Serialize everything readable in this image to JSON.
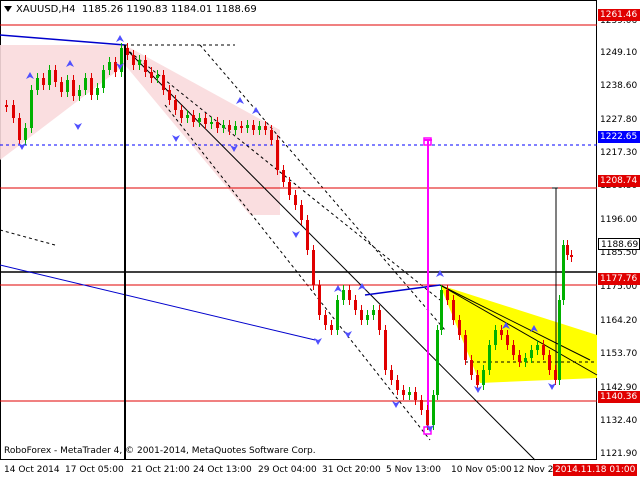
{
  "header": {
    "symbol": "XAUUSD,H4",
    "ohlc": "1185.26 1190.83 1184.01 1188.69"
  },
  "footer": {
    "copyright": "RoboForex - MetaTrader 4, © 2001-2014, MetaQuotes Software Corp."
  },
  "price_axis": {
    "ticks": [
      "1259.06",
      "1249.10",
      "1238.60",
      "1227.80",
      "1217.30",
      "1206.80",
      "1196.00",
      "1185.50",
      "1175.00",
      "1164.20",
      "1153.70",
      "1142.90",
      "1132.40",
      "1121.90"
    ],
    "labels": [
      {
        "text": "1261.46",
        "kind": "red"
      },
      {
        "text": "1222.65",
        "kind": "blue"
      },
      {
        "text": "1208.74",
        "kind": "red"
      },
      {
        "text": "1188.69",
        "kind": "current"
      },
      {
        "text": "1177.76",
        "kind": "red"
      },
      {
        "text": "1140.36",
        "kind": "red"
      }
    ]
  },
  "time_axis": {
    "ticks": [
      "14 Oct 2014",
      "17 Oct 05:00",
      "21 Oct 21:00",
      "24 Oct 13:00",
      "29 Oct 04:00",
      "31 Oct 20:00",
      "5 Nov 13:00",
      "10 Nov 05:00",
      "12 Nov 2"
    ],
    "cursor_label": "2014.11.18 01:00"
  },
  "colors": {
    "bull": "#00b000",
    "bear": "#e00000",
    "support_resistance": "#e00000",
    "target_level": "#0000ff",
    "magenta": "#ff00ff",
    "triangle_fill": "#ffff00",
    "channel_fill": "#fadadd",
    "fractal": "#5050ff"
  },
  "chart_data": {
    "type": "candlestick",
    "ylim": [
      1121.9,
      1263
    ],
    "horizontal_levels": [
      1261.46,
      1222.65,
      1208.74,
      1181.0,
      1177.76,
      1140.36
    ],
    "current_price": 1188.69
  }
}
